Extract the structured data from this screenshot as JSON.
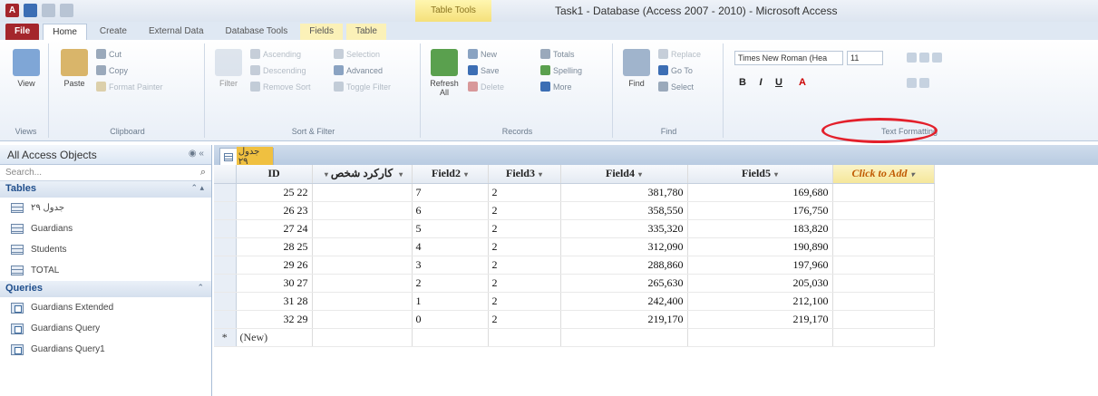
{
  "title_bar": {
    "window_title": "Task1 - Database (Access 2007 - 2010) - Microsoft Access",
    "context_tab_group": "Table Tools",
    "app_logo": "A"
  },
  "ribbon_tabs": [
    "File",
    "Home",
    "Create",
    "External Data",
    "Database Tools",
    "Fields",
    "Table"
  ],
  "ribbon": {
    "views": {
      "view_label": "View",
      "group_label": "Views"
    },
    "clipboard": {
      "paste_label": "Paste",
      "cut_label": "Cut",
      "copy_label": "Copy",
      "format_painter_label": "Format Painter",
      "group_label": "Clipboard"
    },
    "sort_filter": {
      "filter_label": "Filter",
      "ascending_label": "Ascending",
      "descending_label": "Descending",
      "remove_sort_label": "Remove Sort",
      "selection_label": "Selection",
      "advanced_label": "Advanced",
      "toggle_filter_label": "Toggle Filter",
      "group_label": "Sort & Filter"
    },
    "records": {
      "refresh_label": "Refresh All",
      "new_label": "New",
      "save_label": "Save",
      "delete_label": "Delete",
      "totals_label": "Totals",
      "spelling_label": "Spelling",
      "more_label": "More",
      "group_label": "Records"
    },
    "find": {
      "find_label": "Find",
      "replace_label": "Replace",
      "goto_label": "Go To",
      "select_label": "Select",
      "group_label": "Find"
    },
    "text_formatting": {
      "font_name": "Times New Roman (Hea",
      "font_size": "11",
      "bold": "B",
      "italic": "I",
      "underline": "U",
      "font_color": "A",
      "group_label": "Text Formatting"
    }
  },
  "nav_pane": {
    "header": "All Access Objects",
    "search_placeholder": "Search...",
    "groups": [
      {
        "label": "Tables",
        "items": [
          "جدول ٢٩",
          "Guardians",
          "Students",
          "TOTAL"
        ]
      },
      {
        "label": "Queries",
        "items": [
          "Guardians Extended",
          "Guardians Query",
          "Guardians Query1"
        ]
      }
    ]
  },
  "document": {
    "tab_label": "جدول ٢٩",
    "columns": [
      "ID",
      "كاركرد شخص",
      "Field2",
      "Field3",
      "Field4",
      "Field5",
      "Click to Add"
    ],
    "rows": [
      {
        "id": "25 22",
        "f2": "7",
        "f3": "2",
        "f4": "381,780",
        "f5": "169,680"
      },
      {
        "id": "26 23",
        "f2": "6",
        "f3": "2",
        "f4": "358,550",
        "f5": "176,750"
      },
      {
        "id": "27 24",
        "f2": "5",
        "f3": "2",
        "f4": "335,320",
        "f5": "183,820"
      },
      {
        "id": "28 25",
        "f2": "4",
        "f3": "2",
        "f4": "312,090",
        "f5": "190,890"
      },
      {
        "id": "29 26",
        "f2": "3",
        "f3": "2",
        "f4": "288,860",
        "f5": "197,960"
      },
      {
        "id": "30 27",
        "f2": "2",
        "f3": "2",
        "f4": "265,630",
        "f5": "205,030"
      },
      {
        "id": "31 28",
        "f2": "1",
        "f3": "2",
        "f4": "242,400",
        "f5": "212,100"
      },
      {
        "id": "32 29",
        "f2": "0",
        "f3": "2",
        "f4": "219,170",
        "f5": "219,170"
      }
    ],
    "new_row_label": "(New)",
    "new_row_marker": "*"
  },
  "colors": {
    "file_tab": "#a4262c",
    "annotation_ellipse": "#e3202b",
    "context_tab": "#f5e07a"
  }
}
